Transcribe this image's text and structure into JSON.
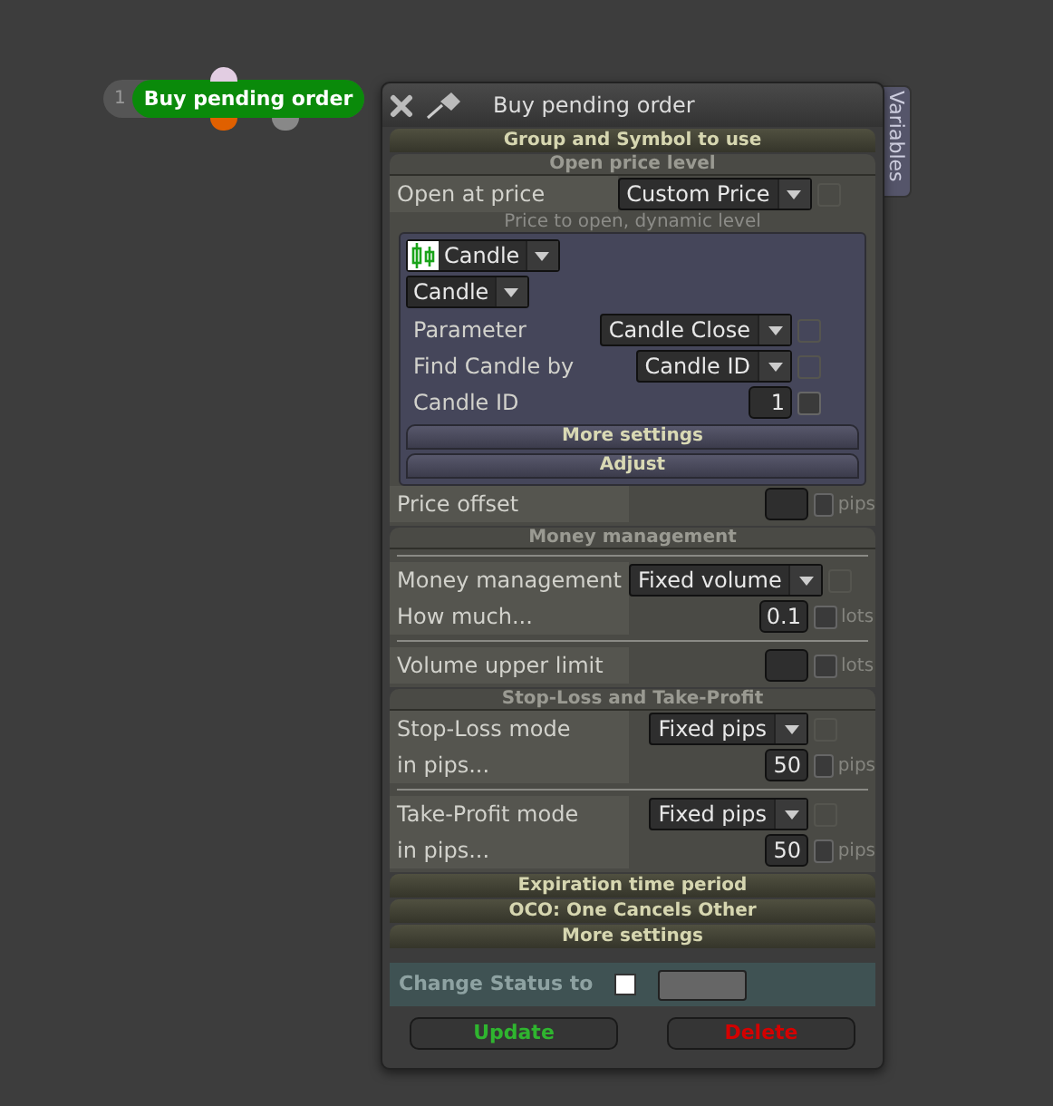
{
  "node": {
    "number": "1",
    "label": "Buy pending order"
  },
  "panel": {
    "title": "Buy pending order",
    "side_tab": "Variables"
  },
  "sections": [
    {
      "kind": "bar",
      "title": "Group and Symbol to use"
    },
    {
      "kind": "group",
      "title": "Open price level",
      "rows": [
        {
          "kind": "select",
          "label": "Open at price",
          "value": "Custom Price",
          "checkbox": {
            "checked": false,
            "disabled": true
          }
        },
        {
          "kind": "caption",
          "text": "Price to open, dynamic level"
        },
        {
          "kind": "subpanel",
          "rows": [
            {
              "kind": "candle_select",
              "value": "Candle"
            },
            {
              "kind": "plain_select",
              "value": "Candle"
            },
            {
              "kind": "select",
              "label": "Parameter",
              "value": "Candle Close",
              "checkbox": {
                "checked": false,
                "disabled": true
              }
            },
            {
              "kind": "select",
              "label": "Find Candle by",
              "value": "Candle ID",
              "checkbox": {
                "checked": false,
                "disabled": true
              }
            },
            {
              "kind": "number",
              "label": "Candle ID",
              "value": "1",
              "checkbox": {
                "checked": false,
                "disabled": false
              }
            },
            {
              "kind": "button",
              "text": "More settings"
            },
            {
              "kind": "button",
              "text": "Adjust"
            }
          ]
        },
        {
          "kind": "number",
          "label": "Price offset",
          "value": "",
          "unit": "pips",
          "checkbox": {
            "checked": false,
            "disabled": false
          }
        }
      ]
    },
    {
      "kind": "group",
      "title": "Money management",
      "rows": [
        {
          "kind": "divider"
        },
        {
          "kind": "select",
          "label": "Money management",
          "value": "Fixed volume",
          "checkbox": {
            "checked": false,
            "disabled": true
          }
        },
        {
          "kind": "number",
          "label": "How much...",
          "value": "0.1",
          "unit": "lots",
          "checkbox": {
            "checked": false,
            "disabled": false
          }
        },
        {
          "kind": "divider"
        },
        {
          "kind": "number",
          "label": "Volume upper limit",
          "value": "",
          "unit": "lots",
          "checkbox": {
            "checked": false,
            "disabled": false
          }
        }
      ]
    },
    {
      "kind": "group",
      "title": "Stop-Loss and Take-Profit",
      "rows": [
        {
          "kind": "select",
          "label": "Stop-Loss mode",
          "value": "Fixed pips",
          "checkbox": {
            "checked": false,
            "disabled": true
          }
        },
        {
          "kind": "number",
          "label": "in pips...",
          "value": "50",
          "unit": "pips",
          "checkbox": {
            "checked": false,
            "disabled": false
          }
        },
        {
          "kind": "divider"
        },
        {
          "kind": "select",
          "label": "Take-Profit mode",
          "value": "Fixed pips",
          "checkbox": {
            "checked": false,
            "disabled": true
          }
        },
        {
          "kind": "number",
          "label": "in pips...",
          "value": "50",
          "unit": "pips",
          "checkbox": {
            "checked": false,
            "disabled": false
          }
        }
      ]
    },
    {
      "kind": "bar",
      "title": "Expiration time period"
    },
    {
      "kind": "bar",
      "title": "OCO: One Cancels Other"
    },
    {
      "kind": "bar",
      "title": "More settings"
    }
  ],
  "status": {
    "label": "Change Status to",
    "checked": false
  },
  "buttons": [
    {
      "kind": "update",
      "text": "Update"
    },
    {
      "kind": "delete",
      "text": "Delete"
    }
  ]
}
